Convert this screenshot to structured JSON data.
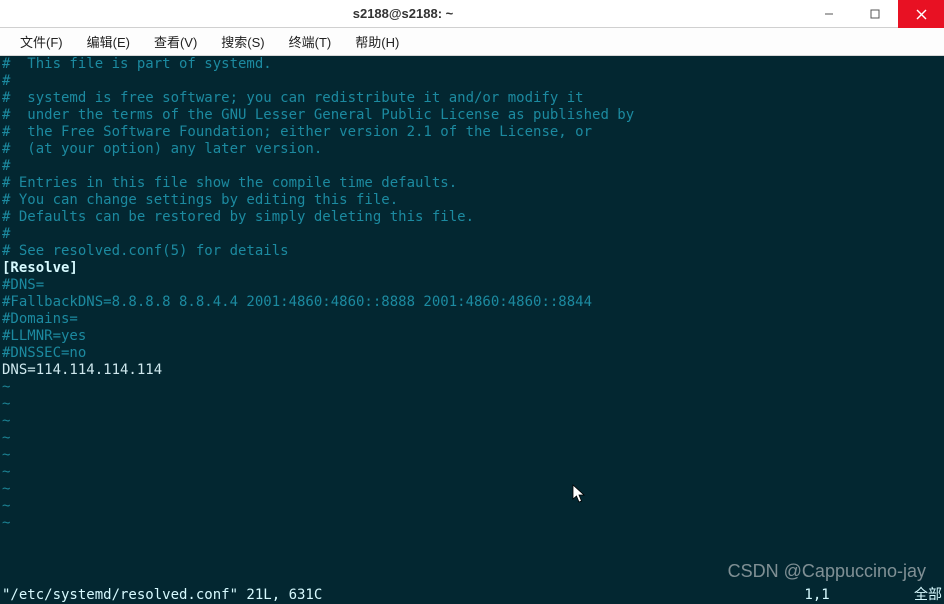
{
  "window": {
    "title": "s2188@s2188: ~"
  },
  "menu": {
    "items": [
      {
        "label": "文件(F)"
      },
      {
        "label": "编辑(E)"
      },
      {
        "label": "查看(V)"
      },
      {
        "label": "搜索(S)"
      },
      {
        "label": "终端(T)"
      },
      {
        "label": "帮助(H)"
      }
    ]
  },
  "file_lines": [
    {
      "cls": "c-comment",
      "text": "#  This file is part of systemd."
    },
    {
      "cls": "c-comment",
      "text": "#"
    },
    {
      "cls": "c-comment",
      "text": "#  systemd is free software; you can redistribute it and/or modify it"
    },
    {
      "cls": "c-comment",
      "text": "#  under the terms of the GNU Lesser General Public License as published by"
    },
    {
      "cls": "c-comment",
      "text": "#  the Free Software Foundation; either version 2.1 of the License, or"
    },
    {
      "cls": "c-comment",
      "text": "#  (at your option) any later version."
    },
    {
      "cls": "c-comment",
      "text": "#"
    },
    {
      "cls": "c-comment",
      "text": "# Entries in this file show the compile time defaults."
    },
    {
      "cls": "c-comment",
      "text": "# You can change settings by editing this file."
    },
    {
      "cls": "c-comment",
      "text": "# Defaults can be restored by simply deleting this file."
    },
    {
      "cls": "c-comment",
      "text": "#"
    },
    {
      "cls": "c-comment",
      "text": "# See resolved.conf(5) for details"
    },
    {
      "cls": "c-white",
      "text": ""
    },
    {
      "cls": "c-bold",
      "text": "[Resolve]"
    },
    {
      "cls": "c-comment",
      "text": "#DNS="
    },
    {
      "cls": "c-comment",
      "text": "#FallbackDNS=8.8.8.8 8.8.4.4 2001:4860:4860::8888 2001:4860:4860::8844"
    },
    {
      "cls": "c-comment",
      "text": "#Domains="
    },
    {
      "cls": "c-comment",
      "text": "#LLMNR=yes"
    },
    {
      "cls": "c-comment",
      "text": "#DNSSEC=no"
    },
    {
      "cls": "c-white",
      "text": ""
    },
    {
      "cls": "c-white",
      "text": "DNS=114.114.114.114"
    }
  ],
  "tilde": "~",
  "status": {
    "file": "\"/etc/systemd/resolved.conf\" 21L, 631C",
    "pos": "1,1",
    "right": "全部"
  },
  "watermark": "CSDN @Cappuccino-jay"
}
